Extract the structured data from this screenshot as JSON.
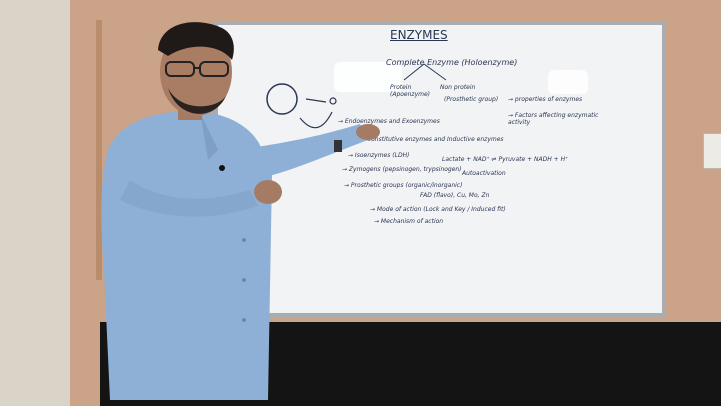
{
  "board": {
    "title": "ENZYMES",
    "line1": "Complete Enzyme (Holoenzyme)",
    "apo": "Protein (Apoenzyme)",
    "nonprotein": "Non protein",
    "prosthetic": "(Prosthetic group)",
    "props": "→ properties of enzymes",
    "factors": "→ Factors affecting enzymatic activity",
    "endo": "→ Endoenzymes and Exoenzymes",
    "constitutive": "→ Constitutive enzymes and Inductive enzymes",
    "isoenzymes": "→ Isoenzymes (LDH)",
    "reaction": "Lactate + NAD⁺ ⇌ Pyruvate + NADH + H⁺",
    "zymogens": "→ Zymogens (pepsinogen, trypsinogen)",
    "activator": "Autoactivation",
    "prosthetic_groups": "→ Prosthetic groups (organic/inorganic)",
    "fad": "FAD (flavo), Cu, Mo, Zn",
    "mode": "→ Mode of action (Lock and Key / Induced fit)",
    "mechanism": "→ Mechanism of action"
  },
  "colors": {
    "marker": "#2a3654",
    "board": "#f2f3f4",
    "shirt": "#8fb0d6"
  }
}
